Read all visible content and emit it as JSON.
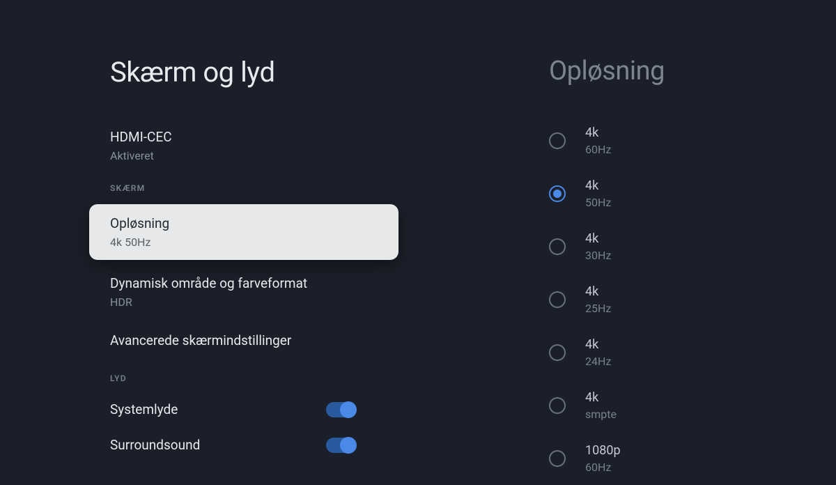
{
  "left": {
    "title": "Skærm og lyd",
    "items": {
      "hdmi_cec": {
        "title": "HDMI-CEC",
        "subtitle": "Aktiveret"
      },
      "section_display": "SKÆRM",
      "resolution": {
        "title": "Opløsning",
        "subtitle": "4k 50Hz"
      },
      "dynamic_range": {
        "title": "Dynamisk område og farveformat",
        "subtitle": "HDR"
      },
      "advanced_display": {
        "title": "Avancerede skærmindstillinger"
      },
      "section_audio": "LYD",
      "system_sounds": {
        "title": "Systemlyde"
      },
      "surround": {
        "title": "Surroundsound"
      }
    }
  },
  "right": {
    "title": "Opløsning",
    "options": [
      {
        "title": "4k",
        "subtitle": "60Hz",
        "selected": false
      },
      {
        "title": "4k",
        "subtitle": "50Hz",
        "selected": true
      },
      {
        "title": "4k",
        "subtitle": "30Hz",
        "selected": false
      },
      {
        "title": "4k",
        "subtitle": "25Hz",
        "selected": false
      },
      {
        "title": "4k",
        "subtitle": "24Hz",
        "selected": false
      },
      {
        "title": "4k",
        "subtitle": "smpte",
        "selected": false
      },
      {
        "title": "1080p",
        "subtitle": "60Hz",
        "selected": false
      }
    ]
  }
}
